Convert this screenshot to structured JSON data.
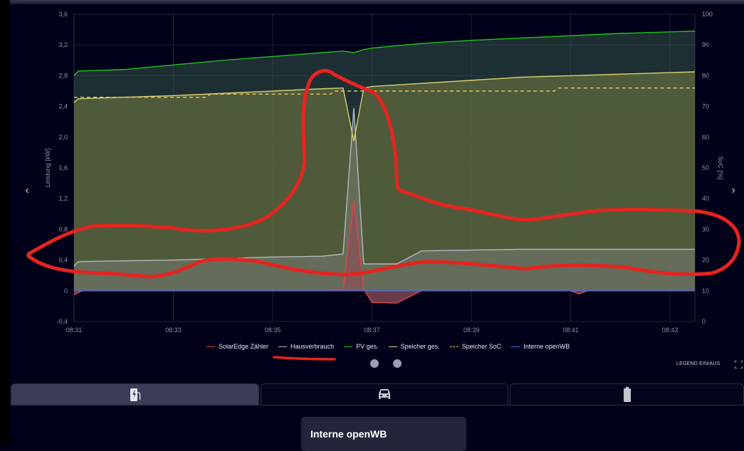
{
  "chart_data": {
    "type": "area",
    "title": "",
    "ylabel": "Leistung [kW]",
    "y2label": "SoC [%]",
    "xlabel": "",
    "ylim": [
      -0.4,
      3.6
    ],
    "y2lim": [
      0,
      100
    ],
    "grid": true,
    "legend_position": "bottom",
    "x_range": [
      "08:31",
      "08:43:30"
    ],
    "xticks": [
      "08:31",
      "08:33",
      "08:35",
      "08:37",
      "08:39",
      "08:41",
      "08:43"
    ],
    "yticks": [
      "-0,4",
      "0",
      "0,4",
      "0,8",
      "1,2",
      "1,6",
      "2,0",
      "2,4",
      "2,8",
      "3,2",
      "3,6"
    ],
    "y2ticks": [
      "0",
      "10",
      "20",
      "30",
      "40",
      "50",
      "60",
      "70",
      "80",
      "90",
      "100"
    ],
    "series": [
      {
        "name": "SolarEdge Zähler",
        "color": "#d9474f",
        "axis": "left",
        "points": [
          [
            "08:31",
            -0.05
          ],
          [
            "08:31:10",
            0.0
          ],
          [
            "08:36:00",
            0.0
          ],
          [
            "08:36:25",
            0.02
          ],
          [
            "08:36:38",
            1.18
          ],
          [
            "08:36:50",
            0.02
          ],
          [
            "08:37:00",
            -0.15
          ],
          [
            "08:37:30",
            -0.16
          ],
          [
            "08:37:50",
            -0.05
          ],
          [
            "08:38:00",
            0.0
          ],
          [
            "08:41:00",
            0.0
          ],
          [
            "08:41:10",
            -0.04
          ],
          [
            "08:41:20",
            0.0
          ],
          [
            "08:43:30",
            0.0
          ]
        ]
      },
      {
        "name": "Hausverbrauch",
        "color": "#b4b8c2",
        "axis": "left",
        "points": [
          [
            "08:31",
            0.32
          ],
          [
            "08:31:05",
            0.38
          ],
          [
            "08:32",
            0.39
          ],
          [
            "08:33",
            0.4
          ],
          [
            "08:34",
            0.42
          ],
          [
            "08:35",
            0.44
          ],
          [
            "08:36",
            0.45
          ],
          [
            "08:36:25",
            0.48
          ],
          [
            "08:36:38",
            2.38
          ],
          [
            "08:36:50",
            0.35
          ],
          [
            "08:37:30",
            0.35
          ],
          [
            "08:38",
            0.52
          ],
          [
            "08:39",
            0.53
          ],
          [
            "08:40",
            0.54
          ],
          [
            "08:41",
            0.54
          ],
          [
            "08:42",
            0.54
          ],
          [
            "08:43",
            0.54
          ],
          [
            "08:43:30",
            0.54
          ]
        ]
      },
      {
        "name": "PV ges.",
        "color": "#22c11a",
        "axis": "left",
        "points": [
          [
            "08:31",
            2.8
          ],
          [
            "08:31:05",
            2.86
          ],
          [
            "08:32",
            2.88
          ],
          [
            "08:33",
            2.94
          ],
          [
            "08:34",
            3.0
          ],
          [
            "08:35",
            3.05
          ],
          [
            "08:36",
            3.1
          ],
          [
            "08:36:25",
            3.12
          ],
          [
            "08:36:38",
            3.1
          ],
          [
            "08:36:50",
            3.14
          ],
          [
            "08:37",
            3.16
          ],
          [
            "08:38",
            3.22
          ],
          [
            "08:39",
            3.26
          ],
          [
            "08:40",
            3.29
          ],
          [
            "08:41",
            3.32
          ],
          [
            "08:42",
            3.35
          ],
          [
            "08:43",
            3.37
          ],
          [
            "08:43:30",
            3.38
          ]
        ]
      },
      {
        "name": "Speicher ges.",
        "color": "#d8d070",
        "axis": "left",
        "points": [
          [
            "08:31",
            2.45
          ],
          [
            "08:31:05",
            2.5
          ],
          [
            "08:32",
            2.52
          ],
          [
            "08:33",
            2.54
          ],
          [
            "08:34",
            2.57
          ],
          [
            "08:35",
            2.6
          ],
          [
            "08:36",
            2.63
          ],
          [
            "08:36:25",
            2.64
          ],
          [
            "08:36:38",
            1.95
          ],
          [
            "08:36:50",
            2.64
          ],
          [
            "08:37",
            2.66
          ],
          [
            "08:38",
            2.7
          ],
          [
            "08:39",
            2.74
          ],
          [
            "08:40",
            2.78
          ],
          [
            "08:41",
            2.8
          ],
          [
            "08:42",
            2.82
          ],
          [
            "08:43",
            2.84
          ],
          [
            "08:43:30",
            2.85
          ]
        ]
      },
      {
        "name": "Speicher SoC",
        "color": "#e6c36a",
        "dashed": true,
        "axis": "right",
        "points": [
          [
            "08:31",
            73
          ],
          [
            "08:33:40",
            73
          ],
          [
            "08:33:45",
            74
          ],
          [
            "08:36:10",
            74
          ],
          [
            "08:36:15",
            75
          ],
          [
            "08:40:40",
            75
          ],
          [
            "08:40:45",
            76
          ],
          [
            "08:43:30",
            76
          ]
        ]
      },
      {
        "name": "Interne openWB",
        "color": "#4d6cd6",
        "axis": "left",
        "points": [
          [
            "08:31",
            0.0
          ],
          [
            "08:43:30",
            0.0
          ]
        ]
      }
    ]
  },
  "controls": {
    "legend_toggle": "LEGEND EIN/AUS",
    "fullscreen_icon": "fullscreen-icon",
    "prev_icon": "chevron-left-icon",
    "next_icon": "chevron-right-icon"
  },
  "tabs": [
    {
      "icon": "ev-charger-icon",
      "active": true
    },
    {
      "icon": "car-icon",
      "active": false
    },
    {
      "icon": "battery-icon",
      "active": false
    }
  ],
  "card": {
    "title": "Interne openWB"
  },
  "annotation": {
    "color": "#e8231f"
  }
}
